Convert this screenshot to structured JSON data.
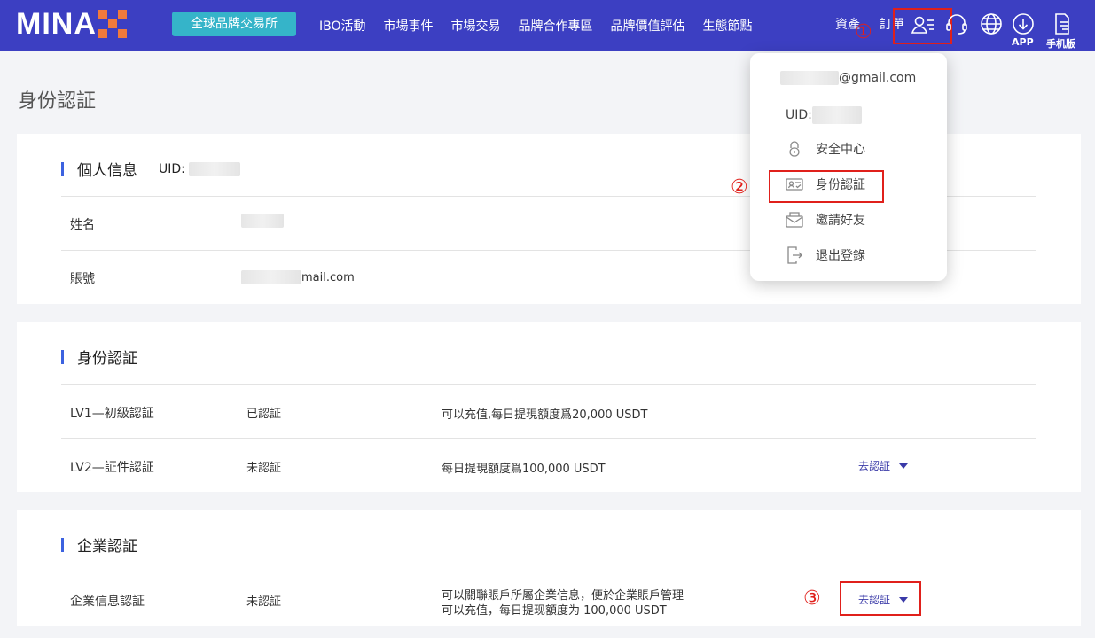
{
  "header": {
    "logo_text": "MINA",
    "cta_label": "全球品牌交易所",
    "nav": [
      "IBO活動",
      "市場事件",
      "市場交易",
      "品牌合作專區",
      "品牌價值評估",
      "生態節點"
    ],
    "assets_label": "資產",
    "orders_label": "訂單",
    "app_label": "APP",
    "mobile_label": "手机版"
  },
  "annotations": {
    "one": "①",
    "two": "②",
    "three": "③"
  },
  "page_title": "身份認証",
  "personal": {
    "title": "個人信息",
    "uid_label": "UID: ",
    "name_label": "姓名",
    "account_label": "賬號",
    "account_value_suffix": "mail.com"
  },
  "identity": {
    "title": "身份認証",
    "rows": [
      {
        "level": "LV1—初級認証",
        "status": "已認証",
        "desc": "可以充值,每日提現額度爲20,000 USDT",
        "action": ""
      },
      {
        "level": "LV2—証件認証",
        "status": "未認証",
        "desc": "每日提現額度爲100,000 USDT",
        "action": "去認証"
      }
    ]
  },
  "enterprise": {
    "title": "企業認証",
    "row": {
      "level": "企業信息認証",
      "status": "未認証",
      "desc_line1": "可以關聯賬戶所屬企業信息，便於企業賬戶管理",
      "desc_line2": "可以充值，每日提现額度为 100,000 USDT",
      "action": "去認証"
    }
  },
  "dropdown": {
    "email_suffix": "@gmail.com",
    "uid_label": "UID: ",
    "items": [
      {
        "label": "安全中心",
        "icon": "lock-icon"
      },
      {
        "label": "身份認証",
        "icon": "id-card-icon"
      },
      {
        "label": "邀請好友",
        "icon": "envelope-icon"
      },
      {
        "label": "退出登錄",
        "icon": "logout-icon"
      }
    ]
  },
  "colors": {
    "header_bg": "#3c3fc2",
    "cta_bg": "#35b4c9",
    "accent_bar": "#3c62e0",
    "annotation_red": "#e0201b",
    "link": "#3a3aa8"
  }
}
